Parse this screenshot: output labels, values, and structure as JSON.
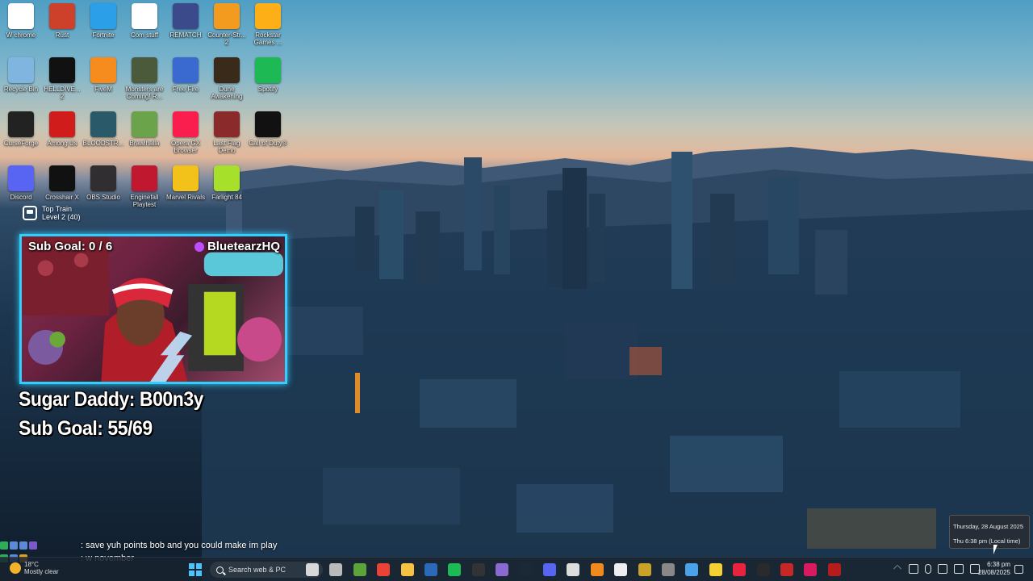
{
  "desktop_icons": [
    {
      "label": "W chrome",
      "icon": "chrome-icon",
      "color": "#ffffff"
    },
    {
      "label": "Rust",
      "icon": "rust-icon",
      "color": "#cd412b"
    },
    {
      "label": "Fortnite",
      "icon": "fortnite-icon",
      "color": "#2b9fe8"
    },
    {
      "label": "Com stuff",
      "icon": "power-icon",
      "color": "#ffffff"
    },
    {
      "label": "REMATCH",
      "icon": "rematch-icon",
      "color": "#3b4a8a"
    },
    {
      "label": "Counter-Str... 2",
      "icon": "counter-strike-icon",
      "color": "#f39b1e"
    },
    {
      "label": "Rockstar Games ...",
      "icon": "rockstar-icon",
      "color": "#fcaf17"
    },
    {
      "label": "Recycle Bin",
      "icon": "recycle-bin-icon",
      "color": "#7fb5de"
    },
    {
      "label": "HELLDIVE... 2",
      "icon": "helldivers-icon",
      "color": "#111111"
    },
    {
      "label": "FiveM",
      "icon": "fivem-icon",
      "color": "#f78c1e"
    },
    {
      "label": "Monsters are Coming! R...",
      "icon": "monsters-icon",
      "color": "#4a5a3a"
    },
    {
      "label": "Free Fire",
      "icon": "free-fire-icon",
      "color": "#3a6ad0"
    },
    {
      "label": "Dune Awakening",
      "icon": "dune-icon",
      "color": "#3a2a1a"
    },
    {
      "label": "Spotify",
      "icon": "spotify-icon",
      "color": "#1db954"
    },
    {
      "label": "CurseForge",
      "icon": "curseforge-icon",
      "color": "#222222"
    },
    {
      "label": "Among Us",
      "icon": "among-us-icon",
      "color": "#d11c1c"
    },
    {
      "label": "BLOODSTR...",
      "icon": "bloodstrike-icon",
      "color": "#2a5a6a"
    },
    {
      "label": "Brawlhalla",
      "icon": "brawlhalla-icon",
      "color": "#6aa34a"
    },
    {
      "label": "Opera GX Browser",
      "icon": "opera-gx-icon",
      "color": "#fa1e4e"
    },
    {
      "label": "Last Flag Demo",
      "icon": "last-flag-icon",
      "color": "#8a2a2a"
    },
    {
      "label": "Call of Duty®",
      "icon": "call-of-duty-icon",
      "color": "#111111"
    },
    {
      "label": "Discord",
      "icon": "discord-icon",
      "color": "#5865f2"
    },
    {
      "label": "Crosshair X",
      "icon": "crosshair-icon",
      "color": "#111111"
    },
    {
      "label": "OBS Studio",
      "icon": "obs-icon",
      "color": "#302e31"
    },
    {
      "label": "Enginefall Playtest",
      "icon": "enginefall-icon",
      "color": "#c0182f"
    },
    {
      "label": "Marvel Rivals",
      "icon": "marvel-rivals-icon",
      "color": "#f2c21b"
    },
    {
      "label": "Farlight 84",
      "icon": "farlight-icon",
      "color": "#a6e02a"
    }
  ],
  "train_widget": {
    "line1": "Top Train",
    "line2": "Level 2  (40)"
  },
  "cam": {
    "sub_goal": "Sub Goal:  0 / 6",
    "handle": "BluetearzHQ"
  },
  "overlay": {
    "line1": "Sugar Daddy: B00n3y",
    "line2": "Sub Goal: 55/69"
  },
  "chat": [
    {
      "text": ": save yuh points bob and you could make im play"
    },
    {
      "text": ": w november"
    }
  ],
  "weather": {
    "temp": "18°C",
    "condition": "Mostly clear"
  },
  "search": {
    "placeholder": "Search web & PC"
  },
  "date_tooltip": {
    "line1": "Thursday, 28 August 2025",
    "line2": "Thu 6:38 pm (Local time)"
  },
  "clock": {
    "time": "6:38 pm",
    "date": "28/08/2025"
  },
  "taskbar_apps": [
    {
      "name": "bird-icon",
      "color": "#d8d8d8"
    },
    {
      "name": "task-view-icon",
      "color": "#bbbbbb"
    },
    {
      "name": "minecraft-icon",
      "color": "#5ba33a"
    },
    {
      "name": "chrome-icon",
      "color": "#ea4335"
    },
    {
      "name": "file-explorer-icon",
      "color": "#f5c242"
    },
    {
      "name": "visual-studio-icon",
      "color": "#2a6ab8"
    },
    {
      "name": "spotify-icon",
      "color": "#1db954"
    },
    {
      "name": "epic-games-icon",
      "color": "#333333"
    },
    {
      "name": "app-icon",
      "color": "#8a6ad0"
    },
    {
      "name": "steam-icon",
      "color": "#1b2838"
    },
    {
      "name": "discord-icon",
      "color": "#5865f2"
    },
    {
      "name": "app-icon",
      "color": "#dddddd"
    },
    {
      "name": "vlc-icon",
      "color": "#f08a1e"
    },
    {
      "name": "app-icon",
      "color": "#eeeeee"
    },
    {
      "name": "app-icon",
      "color": "#c9a227"
    },
    {
      "name": "app-icon",
      "color": "#888888"
    },
    {
      "name": "photos-icon",
      "color": "#4aa3e8"
    },
    {
      "name": "sticky-notes-icon",
      "color": "#f5d033"
    },
    {
      "name": "opera-gx-icon",
      "color": "#e8233d"
    },
    {
      "name": "app-icon",
      "color": "#2a2a2a"
    },
    {
      "name": "app-icon",
      "color": "#c62828"
    },
    {
      "name": "app-icon",
      "color": "#d81b60"
    },
    {
      "name": "app-icon",
      "color": "#b71c1c"
    }
  ]
}
